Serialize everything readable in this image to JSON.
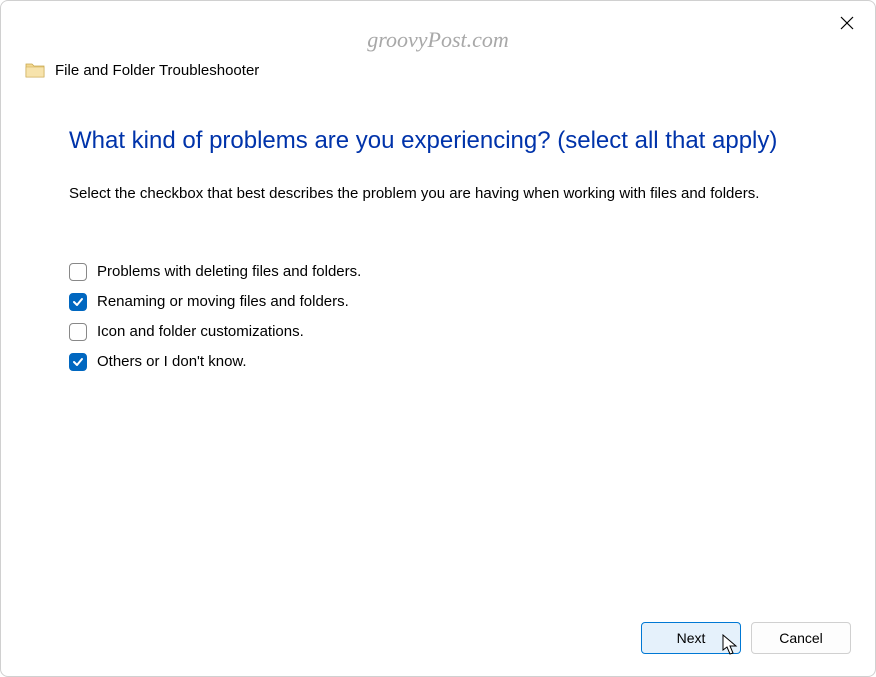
{
  "watermark": "groovyPost.com",
  "header": {
    "title": "File and Folder Troubleshooter"
  },
  "content": {
    "question": "What kind of problems are you experiencing? (select all that apply)",
    "description": "Select the checkbox that best describes the problem you are having when working with files and folders.",
    "options": [
      {
        "label": "Problems with deleting files and folders.",
        "checked": false
      },
      {
        "label": "Renaming or moving files and folders.",
        "checked": true
      },
      {
        "label": "Icon and folder customizations.",
        "checked": false
      },
      {
        "label": "Others or I don't know.",
        "checked": true
      }
    ]
  },
  "footer": {
    "next_label": "Next",
    "cancel_label": "Cancel"
  }
}
